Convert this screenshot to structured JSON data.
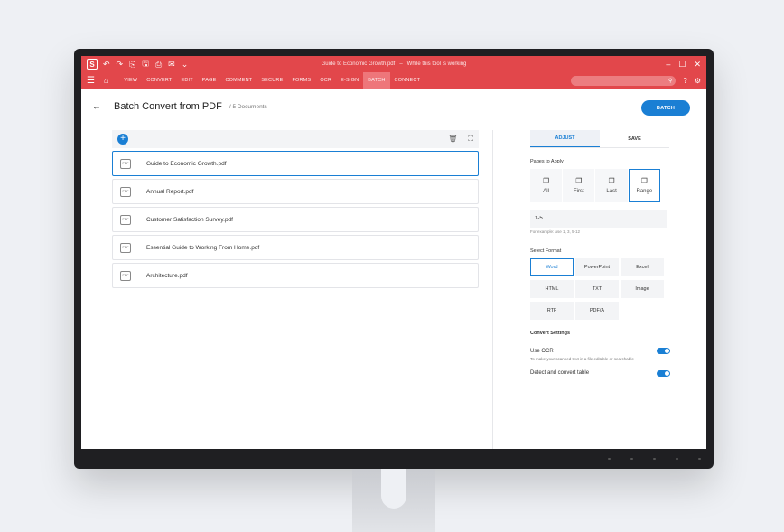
{
  "window": {
    "title": "Guide to Economic Growth.pdf",
    "subtitle": "While this tool is working",
    "logo": "S"
  },
  "quick_access": [
    "↶",
    "↷",
    "⎘",
    "🖫",
    "⎙",
    "✉",
    "⌄"
  ],
  "window_controls": [
    "–",
    "☐",
    "✕"
  ],
  "menu": {
    "items": [
      "VIEW",
      "CONVERT",
      "EDIT",
      "PAGE",
      "COMMENT",
      "SECURE",
      "FORMS",
      "OCR",
      "E-SIGN",
      "BATCH",
      "CONNECT"
    ],
    "active_index": 9,
    "search_placeholder": ""
  },
  "header": {
    "title": "Batch Convert from PDF",
    "doc_count": "/ 5 Documents",
    "batch_button": "BATCH"
  },
  "documents": [
    {
      "name": "Guide to Economic Growth.pdf",
      "selected": true
    },
    {
      "name": "Annual Report.pdf",
      "selected": false
    },
    {
      "name": "Customer Satisfaction Survey.pdf",
      "selected": false
    },
    {
      "name": "Essential Guide to Working From Home.pdf",
      "selected": false
    },
    {
      "name": "Architecture.pdf",
      "selected": false
    }
  ],
  "doc_icon_text": "PDF",
  "panel": {
    "tabs": [
      "ADJUST",
      "SAVE"
    ],
    "active_tab": 0,
    "pages_label": "Pages to Apply",
    "pages": [
      {
        "label": "All",
        "icon": "❐"
      },
      {
        "label": "First",
        "icon": "❐"
      },
      {
        "label": "Last",
        "icon": "❐"
      },
      {
        "label": "Range",
        "icon": "❐"
      }
    ],
    "active_page": 3,
    "range_value": "1-5",
    "range_hint": "For example: use 1, 3, 5-12",
    "format_label": "Select Format",
    "formats": [
      "Word",
      "PowerPoint",
      "Excel",
      "HTML",
      "TXT",
      "Image",
      "RTF",
      "PDF/A"
    ],
    "active_format": 0,
    "convert_settings_label": "Convert Settings",
    "use_ocr_label": "Use OCR",
    "use_ocr_desc": "To make your scanned text in a file editable or searchable",
    "detect_table_label": "Detect and convert table"
  },
  "colors": {
    "brand_red": "#e2474b",
    "accent_blue": "#1a7fd4"
  }
}
